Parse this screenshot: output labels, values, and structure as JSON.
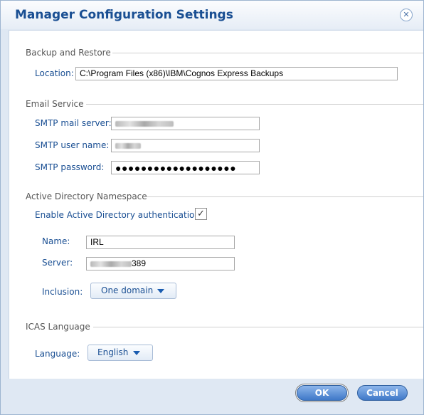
{
  "dialog": {
    "title": "Manager Configuration Settings"
  },
  "backup": {
    "heading": "Backup and Restore",
    "location_label": "Location:",
    "location_value": "C:\\Program Files (x86)\\IBM\\Cognos Express Backups"
  },
  "email": {
    "heading": "Email Service",
    "smtp_server_label": "SMTP mail server:",
    "smtp_user_label": "SMTP user name:",
    "smtp_password_label": "SMTP password:",
    "smtp_password_value": "●●●●●●●●●●●●●●●●●●●"
  },
  "ad": {
    "heading": "Active Directory Namespace",
    "enable_label": "Enable Active Directory authentication:",
    "enable_checked": true,
    "check_mark": "✓",
    "name_label": "Name:",
    "name_value": "IRL",
    "server_label": "Server:",
    "server_value_suffix": "389",
    "inclusion_label": "Inclusion:",
    "inclusion_value": "One domain"
  },
  "icas": {
    "heading": "ICAS Language",
    "language_label": "Language:",
    "language_value": "English"
  },
  "buttons": {
    "ok": "OK",
    "cancel": "Cancel"
  },
  "icons": {
    "close": "close-icon",
    "dropdown": "triangle-down-icon",
    "check": "checkmark-icon"
  },
  "colors": {
    "accent": "#1a4f93",
    "button": "#3f78c8"
  }
}
